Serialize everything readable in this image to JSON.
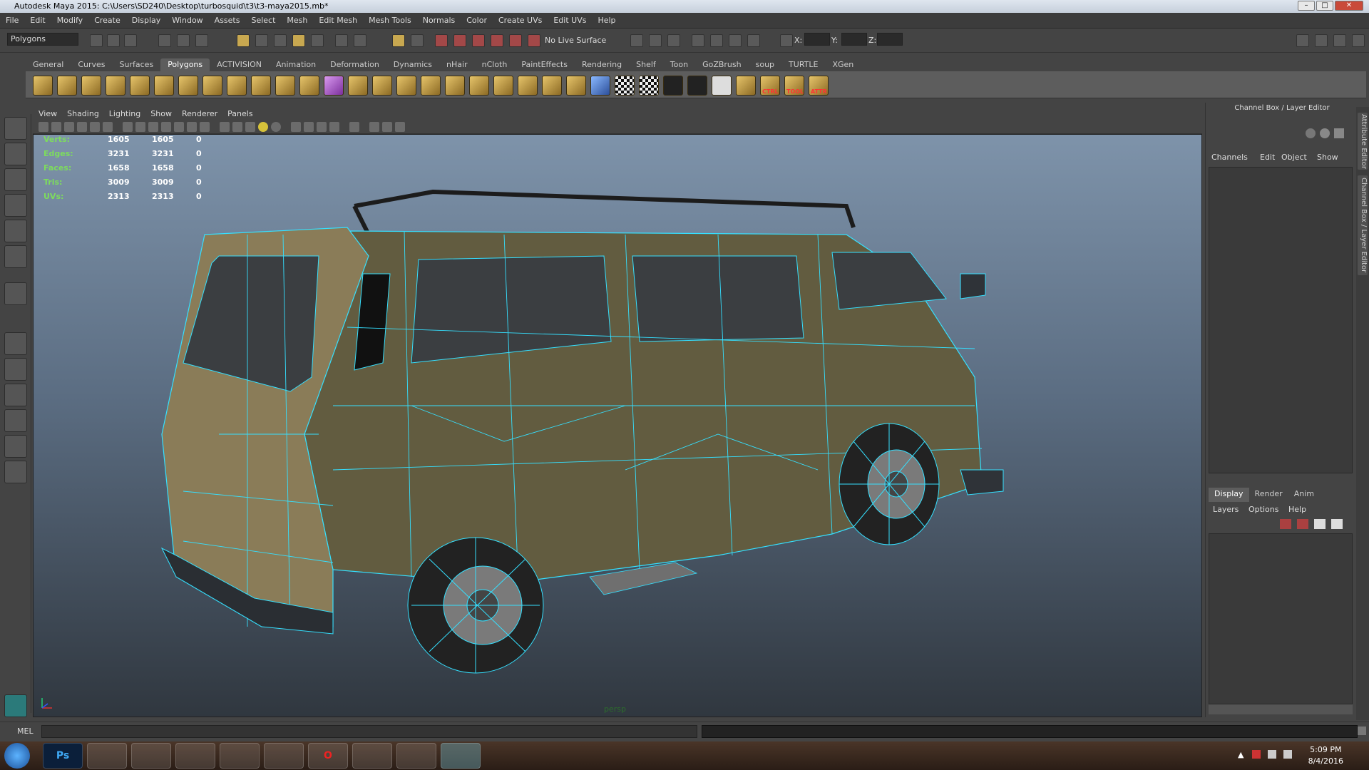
{
  "window": {
    "title": "Autodesk Maya 2015: C:\\Users\\SD240\\Desktop\\turbosquid\\t3\\t3-maya2015.mb*"
  },
  "menubar": [
    "File",
    "Edit",
    "Modify",
    "Create",
    "Display",
    "Window",
    "Assets",
    "Select",
    "Mesh",
    "Edit Mesh",
    "Mesh Tools",
    "Normals",
    "Color",
    "Create UVs",
    "Edit UVs",
    "Help"
  ],
  "statusline": {
    "menuset": "Polygons",
    "live_surface": "No Live Surface",
    "x_label": "X:",
    "y_label": "Y:",
    "z_label": "Z:"
  },
  "shelf": {
    "tabs": [
      "General",
      "Curves",
      "Surfaces",
      "Polygons",
      "ACTIVISION",
      "Animation",
      "Deformation",
      "Dynamics",
      "nHair",
      "nCloth",
      "PaintEffects",
      "Rendering",
      "Shelf",
      "Toon",
      "GoZBrush",
      "soup",
      "TURTLE",
      "XGen"
    ],
    "active_tab": "Polygons",
    "button_labels": [
      "CTRL",
      "TOOL",
      "ATTR"
    ]
  },
  "panel": {
    "menu": [
      "View",
      "Shading",
      "Lighting",
      "Show",
      "Renderer",
      "Panels"
    ],
    "camera": "persp"
  },
  "hud": [
    {
      "label": "Verts:",
      "a": "1605",
      "b": "1605",
      "c": "0"
    },
    {
      "label": "Edges:",
      "a": "3231",
      "b": "3231",
      "c": "0"
    },
    {
      "label": "Faces:",
      "a": "1658",
      "b": "1658",
      "c": "0"
    },
    {
      "label": "Tris:",
      "a": "3009",
      "b": "3009",
      "c": "0"
    },
    {
      "label": "UVs:",
      "a": "2313",
      "b": "2313",
      "c": "0"
    }
  ],
  "channelbox": {
    "title": "Channel Box / Layer Editor",
    "menu": [
      "Channels",
      "Edit",
      "Object",
      "Show"
    ],
    "layer_tabs": [
      "Display",
      "Render",
      "Anim"
    ],
    "layer_menu": [
      "Layers",
      "Options",
      "Help"
    ]
  },
  "sidetabs": [
    "Attribute Editor",
    "Channel Box / Layer Editor"
  ],
  "cmdline": {
    "label": "MEL"
  },
  "taskbar": {
    "apps": [
      "Start",
      "Photoshop",
      "Paint",
      "Internet Explorer",
      "File Explorer",
      "Media Player",
      "Winamp",
      "Opera",
      "Chrome",
      "Viber",
      "Maya"
    ],
    "app_text": {
      "photoshop": "Ps"
    },
    "time": "5:09 PM",
    "date": "8/4/2016"
  },
  "colors": {
    "wire": "#35e0ff",
    "hud_label": "#7ddc5d",
    "van_body": "#6b6447"
  }
}
